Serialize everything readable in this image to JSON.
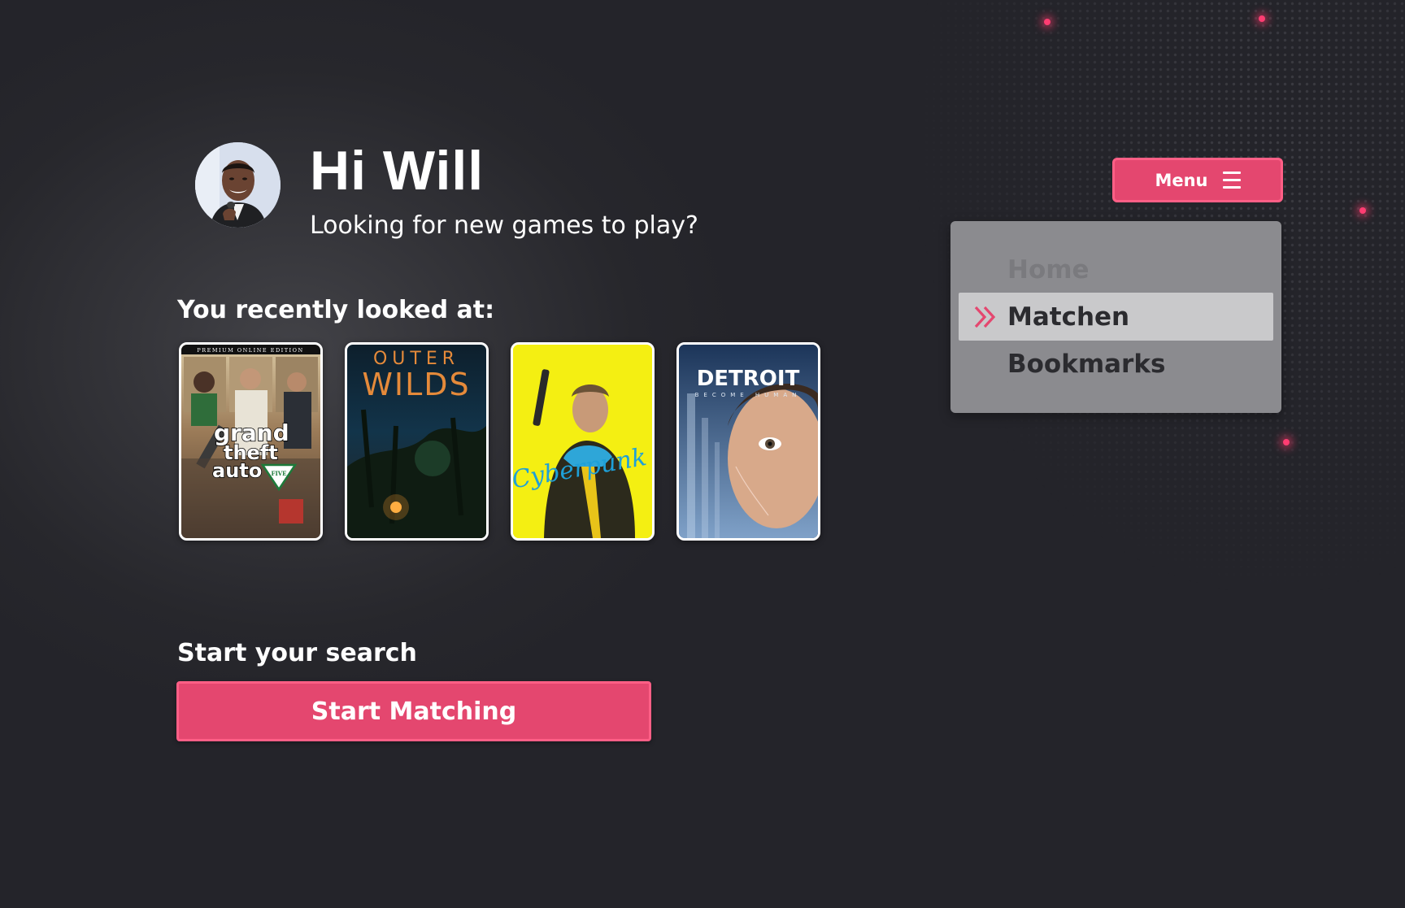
{
  "header": {
    "greeting": "Hi Will",
    "subtitle": "Looking for new games to play?"
  },
  "recent": {
    "heading": "You recently looked at:",
    "games": [
      {
        "title": "Grand Theft Auto V",
        "cover_text": [
          "PREMIUM ONLINE EDITION",
          "grand",
          "theft",
          "auto",
          "FIVE"
        ]
      },
      {
        "title": "Outer Wilds",
        "cover_text": [
          "OUTER",
          "WILDS"
        ]
      },
      {
        "title": "Cyberpunk 2077",
        "cover_text": [
          "Cyberpunk"
        ]
      },
      {
        "title": "Detroit: Become Human",
        "cover_text": [
          "DETROIT",
          "BECOME HUMAN"
        ]
      }
    ]
  },
  "search": {
    "heading": "Start your search",
    "button_label": "Start Matching"
  },
  "menu": {
    "button_label": "Menu",
    "button_icon": "hamburger-icon",
    "items": [
      {
        "label": "Home",
        "state": "disabled"
      },
      {
        "label": "Matchen",
        "state": "active",
        "icon": "double-chevron-right-icon"
      },
      {
        "label": "Bookmarks",
        "state": "normal"
      }
    ]
  },
  "colors": {
    "accent": "#e4476f",
    "accent_border": "#ff5f86",
    "background": "#25252a",
    "dropdown_bg": "#8b8b8f",
    "dropdown_active_bg": "#c9c9cb"
  }
}
